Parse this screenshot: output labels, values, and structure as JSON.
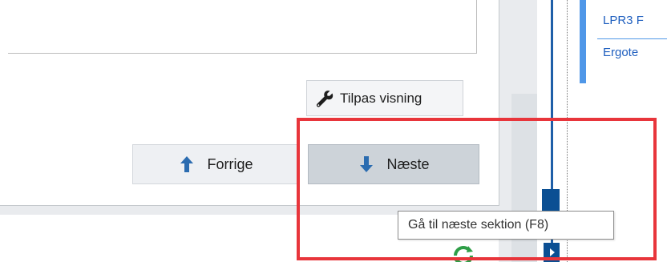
{
  "toolbar": {
    "customize_view_label": "Tilpas visning",
    "customize_view_icon": "wrench-icon"
  },
  "navigation": {
    "previous_label": "Forrige",
    "previous_icon": "arrow-up-icon",
    "next_label": "Næste",
    "next_icon": "arrow-down-icon"
  },
  "tooltip": {
    "text": "Gå til næste sektion (F8)"
  },
  "side_panel": {
    "items": [
      {
        "label": "LPR3 F"
      },
      {
        "label": "Ergote"
      }
    ]
  },
  "colors": {
    "accent_blue": "#1f5fbf",
    "timeline_blue": "#0b4f93",
    "highlight_red": "#e8353b",
    "refresh_green": "#2e9e47"
  }
}
